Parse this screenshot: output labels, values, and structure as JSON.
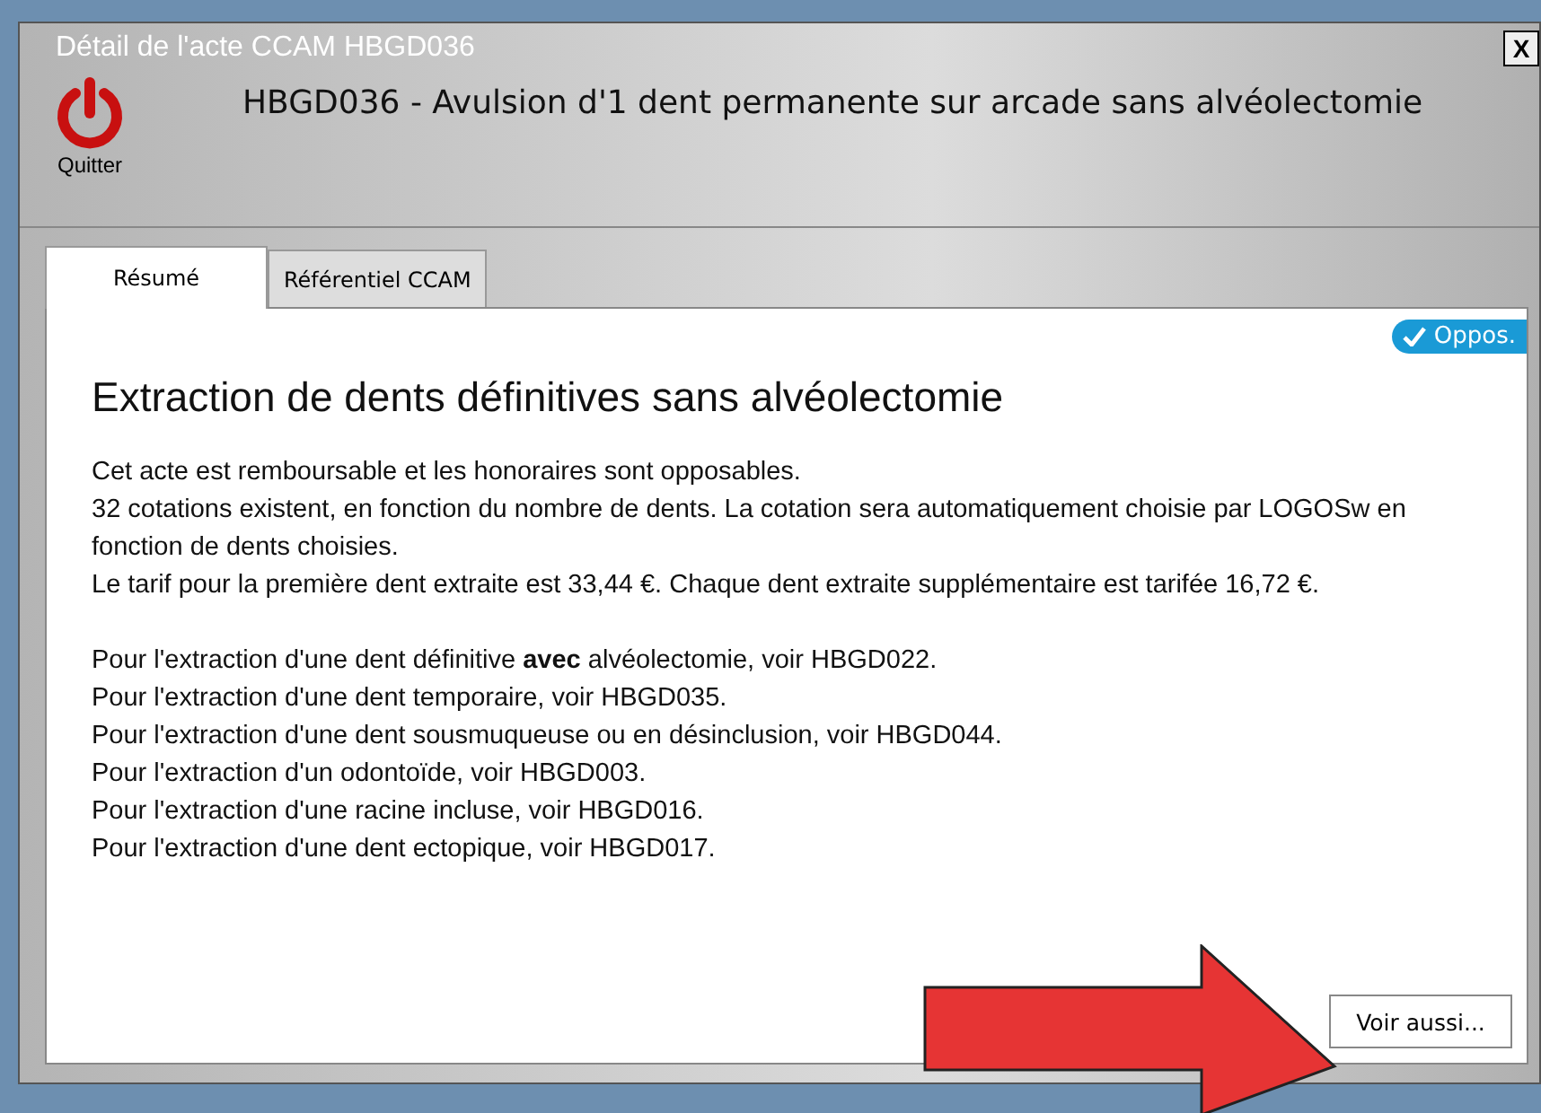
{
  "window": {
    "title": "Détail de l'acte CCAM HBGD036",
    "close": "X"
  },
  "header": {
    "quit_label": "Quitter",
    "act_title": "HBGD036 - Avulsion d'1 dent permanente sur arcade sans alvéolectomie"
  },
  "tabs": [
    {
      "label": "Résumé",
      "selected": true
    },
    {
      "label": "Référentiel CCAM",
      "selected": false
    }
  ],
  "badge": {
    "label": "Oppos.",
    "checked": true
  },
  "heading": "Extraction de dents définitives sans alvéolectomie",
  "paragraphs": [
    "Cet acte est remboursable et les honoraires sont opposables.",
    "32 cotations existent, en fonction du nombre de dents. La cotation sera automatiquement choisie par LOGOSw en fonction de dents choisies.",
    "Le tarif pour la première dent extraite est 33,44 €. Chaque dent extraite supplémentaire est tarifée 16,72 €."
  ],
  "references": [
    "Pour l'extraction d'une dent définitive **avec** alvéolectomie, voir HBGD022.",
    "Pour l'extraction d'une dent temporaire, voir HBGD035.",
    "Pour l'extraction d'une dent sousmuqueuse ou en désinclusion, voir HBGD044.",
    "Pour l'extraction d'un odontoïde, voir HBGD003.",
    "Pour l'extraction d'une racine incluse, voir HBGD016.",
    "Pour l'extraction d'une dent ectopique, voir HBGD017."
  ],
  "see_also_button": "Voir aussi..."
}
